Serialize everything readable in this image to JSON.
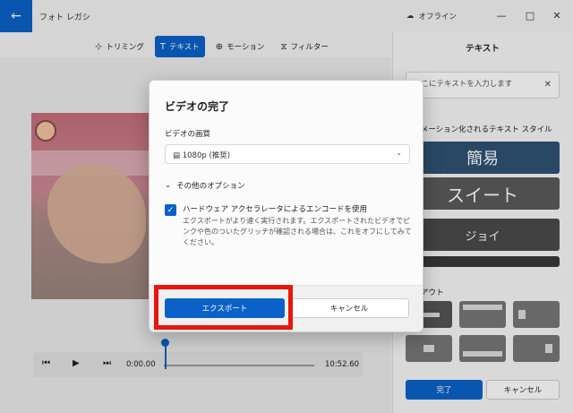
{
  "app": {
    "title": "フォト レガシ",
    "offline_label": "オフライン"
  },
  "window_controls": {
    "minimize": "—",
    "maximize": "□",
    "close": "✕"
  },
  "toolbar": {
    "items": [
      {
        "label": "トリミング",
        "icon": "crop-icon"
      },
      {
        "label": "テキスト",
        "icon": "text-icon",
        "active": true
      },
      {
        "label": "モーション",
        "icon": "motion-icon"
      },
      {
        "label": "フィルター",
        "icon": "filter-icon"
      }
    ]
  },
  "player": {
    "current_time": "0:00.00",
    "end_time": "10:52.60",
    "progress": 0
  },
  "panel": {
    "title": "テキスト",
    "input_placeholder": "ここにテキストを入力します",
    "style_label": "アニメーション化されるテキスト スタイル",
    "styles": [
      "簡易",
      "スイート",
      "ジョイ"
    ],
    "layout_label": "レイアウト",
    "done": "完了",
    "cancel": "キャンセル"
  },
  "dialog": {
    "title": "ビデオの完了",
    "quality_label": "ビデオの画質",
    "quality_value": "1080p (推奨)",
    "more_options": "その他のオプション",
    "hw_accel_label": "ハードウェア アクセラレータによるエンコードを使用",
    "hw_accel_checked": true,
    "hw_accel_desc": "エクスポートがより速く実行されます。エクスポートされたビデオでピンクや色のついたグリッチが確認される場合は、これをオフにしてみてください。",
    "export": "エクスポート",
    "cancel": "キャンセル"
  },
  "colors": {
    "accent": "#0a62c9",
    "highlight": "#e8160c"
  }
}
